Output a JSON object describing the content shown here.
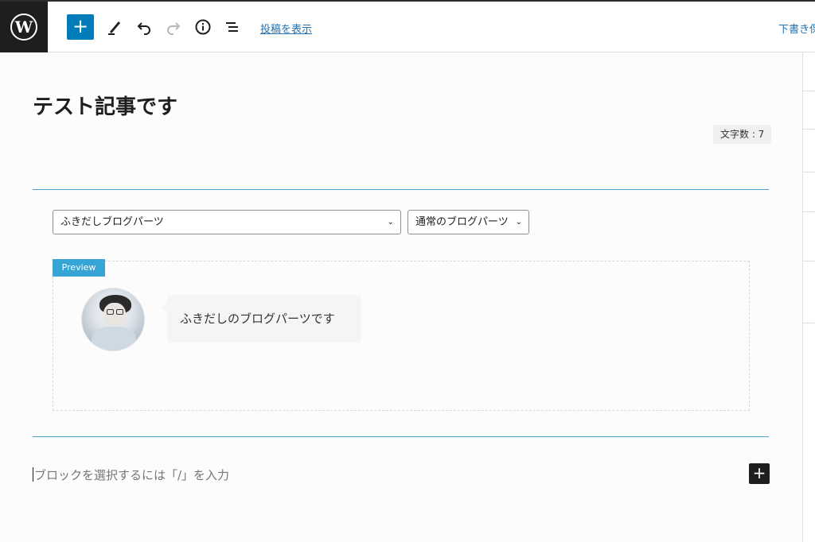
{
  "toolbar": {
    "add_symbol": "+",
    "preview_link": "投稿を表示",
    "save_draft": "下書き保"
  },
  "editor": {
    "post_title": "テスト記事です",
    "char_count": "文字数 : 7",
    "block": {
      "select_main": "ふきだしブログパーツ",
      "select_type": "通常のブログパーツ",
      "preview_label": "Preview",
      "bubble_text": "ふきだしのブログパーツです"
    },
    "appender_placeholder": "ブロックを選択するには「/」を入力",
    "add_block_symbol": "+"
  },
  "colors": {
    "accent": "#007cba",
    "preview_tag": "#37a4d6",
    "block_line": "#4aa3cf"
  },
  "icons": [
    "wordpress-logo-icon",
    "plus-icon",
    "pencil-icon",
    "undo-icon",
    "redo-icon",
    "info-icon",
    "list-view-icon",
    "chevron-down-icon"
  ]
}
